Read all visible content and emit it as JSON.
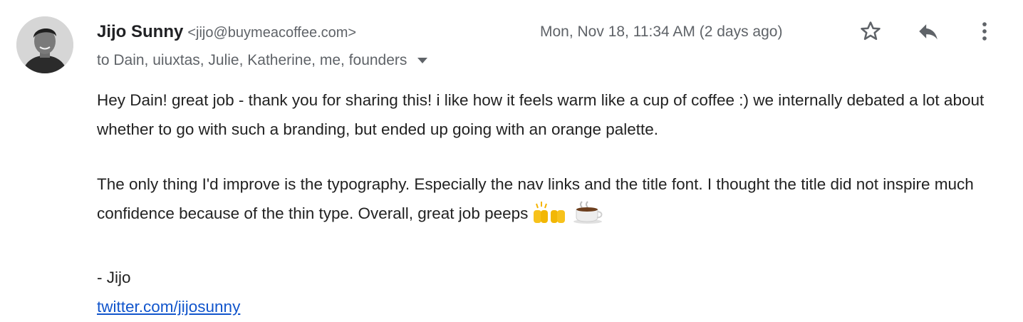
{
  "sender": {
    "name": "Jijo Sunny",
    "email": "<jijo@buymeacoffee.com>"
  },
  "recipients": "to Dain, uiuxtas, Julie, Katherine, me, founders",
  "timestamp": "Mon, Nov 18, 11:34 AM (2 days ago)",
  "icons": {
    "star": "star-outline-icon",
    "reply": "reply-icon",
    "more": "more-vertical-icon",
    "details": "caret-down-icon"
  },
  "body": {
    "paragraph_1": "Hey Dain! great job - thank you for sharing this! i like how it feels warm like a cup of coffee :) we internally debated a lot about whether to go with such a branding, but ended up going with an orange palette.",
    "paragraph_2": "The only thing I'd improve is the typography. Especially the nav links and the title font. I thought the title did not inspire much confidence because of the thin type. Overall, great job peeps",
    "emoji_1": "raising-hands",
    "emoji_2": "hot-beverage",
    "signature": "- Jijo",
    "link": "twitter.com/jijosunny"
  },
  "colors": {
    "text": "#222222",
    "meta": "#5f6368",
    "link": "#1155cc"
  }
}
